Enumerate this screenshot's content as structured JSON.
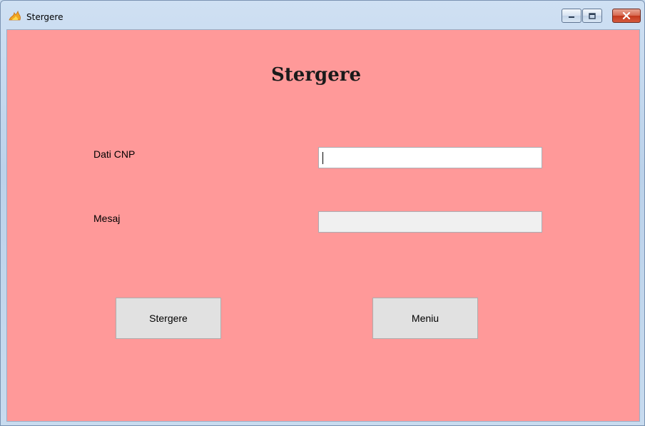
{
  "window": {
    "title": "Stergere",
    "app_icon": "flame-icon",
    "controls": [
      "minimize-icon",
      "maximize-icon",
      "close-icon"
    ]
  },
  "form": {
    "heading": "Stergere",
    "cnp_label": "Dati CNP",
    "cnp_value": "",
    "message_label": "Mesaj",
    "message_value": ""
  },
  "buttons": {
    "delete_label": "Stergere",
    "menu_label": "Meniu"
  },
  "colors": {
    "background": "#ff9999",
    "button": "#e1e1e1",
    "input_disabled": "#f0f0f0"
  }
}
